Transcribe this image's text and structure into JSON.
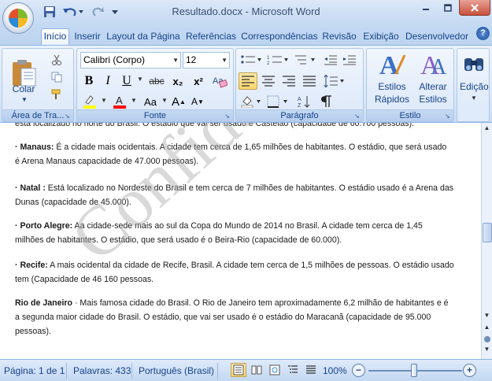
{
  "window": {
    "title": "Resultado.docx - Microsoft Word"
  },
  "tabs": [
    {
      "label": "Início",
      "active": true
    },
    {
      "label": "Inserir"
    },
    {
      "label": "Layout da Página"
    },
    {
      "label": "Referências"
    },
    {
      "label": "Correspondências"
    },
    {
      "label": "Revisão"
    },
    {
      "label": "Exibição"
    },
    {
      "label": "Desenvolvedor"
    }
  ],
  "help_label": "?",
  "ribbon": {
    "clipboard": {
      "label": "Área de Tra...",
      "paste_label": "Colar"
    },
    "font": {
      "label": "Fonte",
      "font_name": "Calibri (Corpo)",
      "font_size": "12",
      "bold": "B",
      "italic": "I",
      "underline": "U",
      "strike": "abc",
      "subscript": "x₂",
      "superscript": "x²",
      "case": "Aa",
      "grow": "A",
      "shrink": "A",
      "highlight_color": "#ffff00",
      "font_color": "#ff0000"
    },
    "paragraph": {
      "label": "Parágrafo"
    },
    "styles": {
      "label": "Estilo",
      "quick_label_1": "Estilos",
      "quick_label_2": "Rápidos",
      "change_label_1": "Alterar",
      "change_label_2": "Estilos"
    },
    "editing": {
      "label": "Edição"
    }
  },
  "document": {
    "cut_line": "está localizado no norte do Brasil. O estádio que vai ser usado é Castelão (capacidade de 60.700 pessoas).",
    "paragraphs": [
      {
        "bold": "· Manaus:",
        "line1": " É a cidade mais ocidentais. A cidade tem cerca de 1,65 milhões de habitantes. O estádio, que será usado",
        "line2": "é Arena Manaus capacidade de 47.000 pessoas)."
      },
      {
        "bold": "· Natal :",
        "line1": " Está localizado no Nordeste do Brasil e tem cerca de 7 milhões de habitantes. O estádio usado é a Arena das",
        "line2": "Dunas (capacidade de 45.000)."
      },
      {
        "bold": "· Porto Alegre:",
        "line1": " Aa cidade-sede mais ao sul da Copa do Mundo de 2014 no Brasil. A cidade tem cerca de 1,45",
        "line2": "milhões de habitantes. O estádio, que será usado é o Beira-Rio (capacidade de 60.000)."
      },
      {
        "bold": "· Recife:",
        "line1": " A mais ocidental da cidade de Recife, Brasil. A cidade tem cerca de 1,5 milhões de pessoas. O estádio usado",
        "line2": "tem (Capacidade de 46 160 pessoas."
      },
      {
        "bold": "Rio de Janeiro",
        "line1": " · Mais famosa cidade do Brasil. O Rio de Janeiro tem aproximadamente 6,2 milhão de habitantes e é",
        "line2": "a segunda maior cidade do Brasil. O estádio, que vai ser usado é o estádio do Maracanã (capacidade de 95.000",
        "line3": "pessoas)."
      }
    ],
    "watermark": "Confidencial"
  },
  "status": {
    "page": "Página: 1 de 1",
    "words": "Palavras: 433",
    "language": "Português (Brasil)",
    "zoom": "100%",
    "zoom_minus": "−",
    "zoom_plus": "+",
    "zoom_level_percent": 100
  }
}
